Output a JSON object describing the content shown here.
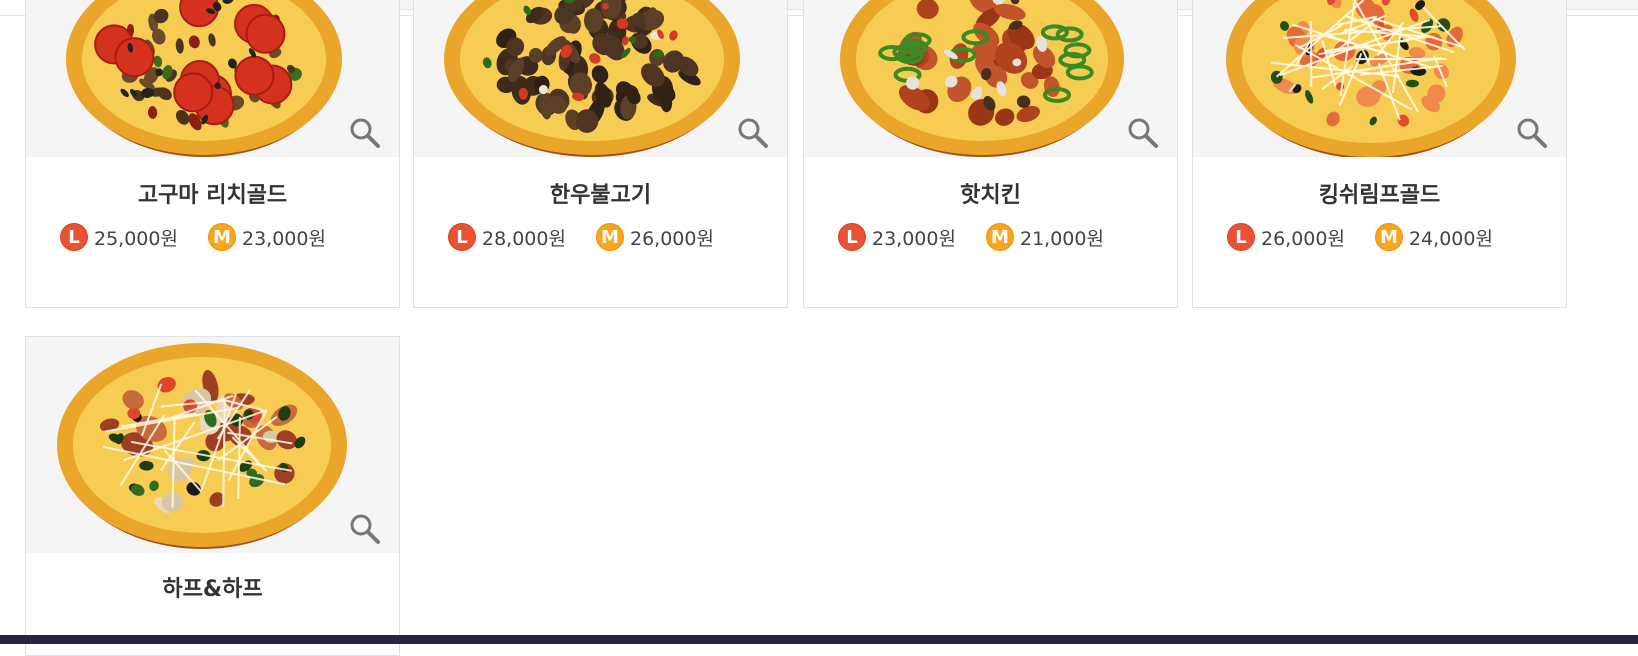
{
  "products": [
    {
      "name": "고구마 리치골드",
      "price_large": "25,000원",
      "price_medium": "23,000원",
      "size_large": "L",
      "size_medium": "M",
      "toppings": "pepperoni"
    },
    {
      "name": "한우불고기",
      "price_large": "28,000원",
      "price_medium": "26,000원",
      "size_large": "L",
      "size_medium": "M",
      "toppings": "bulgogi"
    },
    {
      "name": "핫치킨",
      "price_large": "23,000원",
      "price_medium": "21,000원",
      "size_large": "L",
      "size_medium": "M",
      "toppings": "chicken"
    },
    {
      "name": "킹쉬림프골드",
      "price_large": "26,000원",
      "price_medium": "24,000원",
      "size_large": "L",
      "size_medium": "M",
      "toppings": "shrimp"
    },
    {
      "name": "하프&하프",
      "toppings": "half"
    }
  ],
  "colors": {
    "large_badge": "#ea5235",
    "medium_badge": "#f9a51e",
    "footer": "#2b2440"
  },
  "icons": {
    "zoom": "magnifier-icon"
  }
}
